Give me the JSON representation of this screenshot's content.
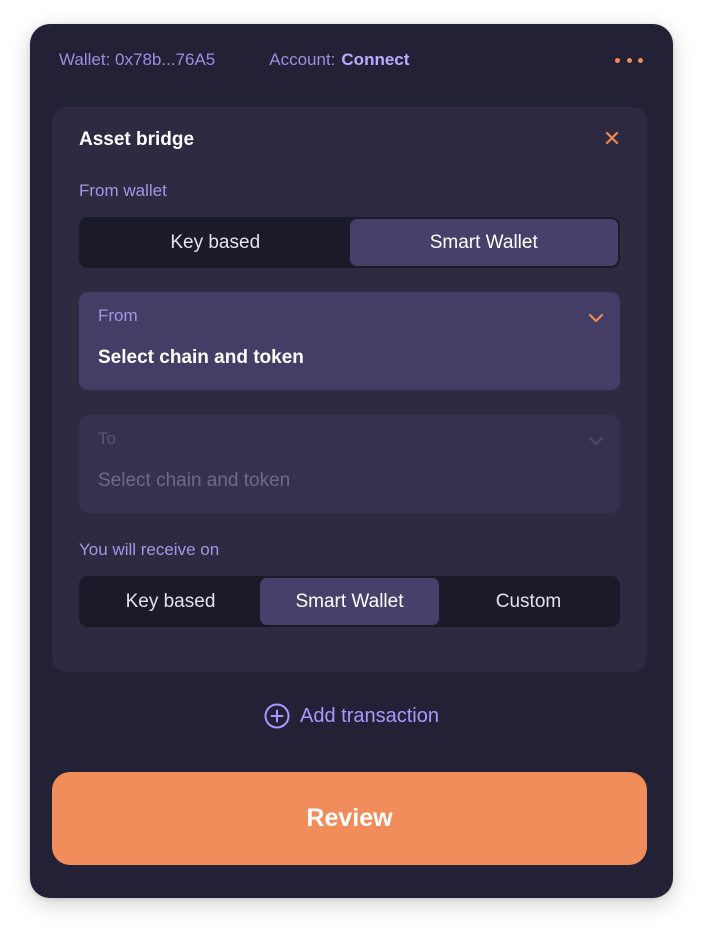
{
  "header": {
    "wallet_text": "Wallet: 0x78b...76A5",
    "account_label": "Account:",
    "account_link": "Connect",
    "more_icon": "more-horizontal-icon"
  },
  "bridge": {
    "title": "Asset bridge",
    "close_icon": "close-icon",
    "from_wallet_label": "From wallet",
    "from_wallet_options": [
      "Key based",
      "Smart Wallet"
    ],
    "from_wallet_selected": "Smart Wallet",
    "from": {
      "label": "From",
      "value": "Select chain and token",
      "icon": "chevron-down-icon"
    },
    "to": {
      "label": "To",
      "value": "Select chain and token",
      "icon": "chevron-down-icon",
      "disabled": true
    },
    "receive_label": "You will receive on",
    "receive_options": [
      "Key based",
      "Smart Wallet",
      "Custom"
    ],
    "receive_selected": "Smart Wallet"
  },
  "add_transaction": {
    "label": "Add transaction",
    "icon": "plus-circle-icon"
  },
  "review_button": "Review",
  "colors": {
    "panel_bg": "#232136",
    "card_bg": "#2d2a42",
    "accent": "#f08d5a",
    "link": "#a898ff"
  }
}
